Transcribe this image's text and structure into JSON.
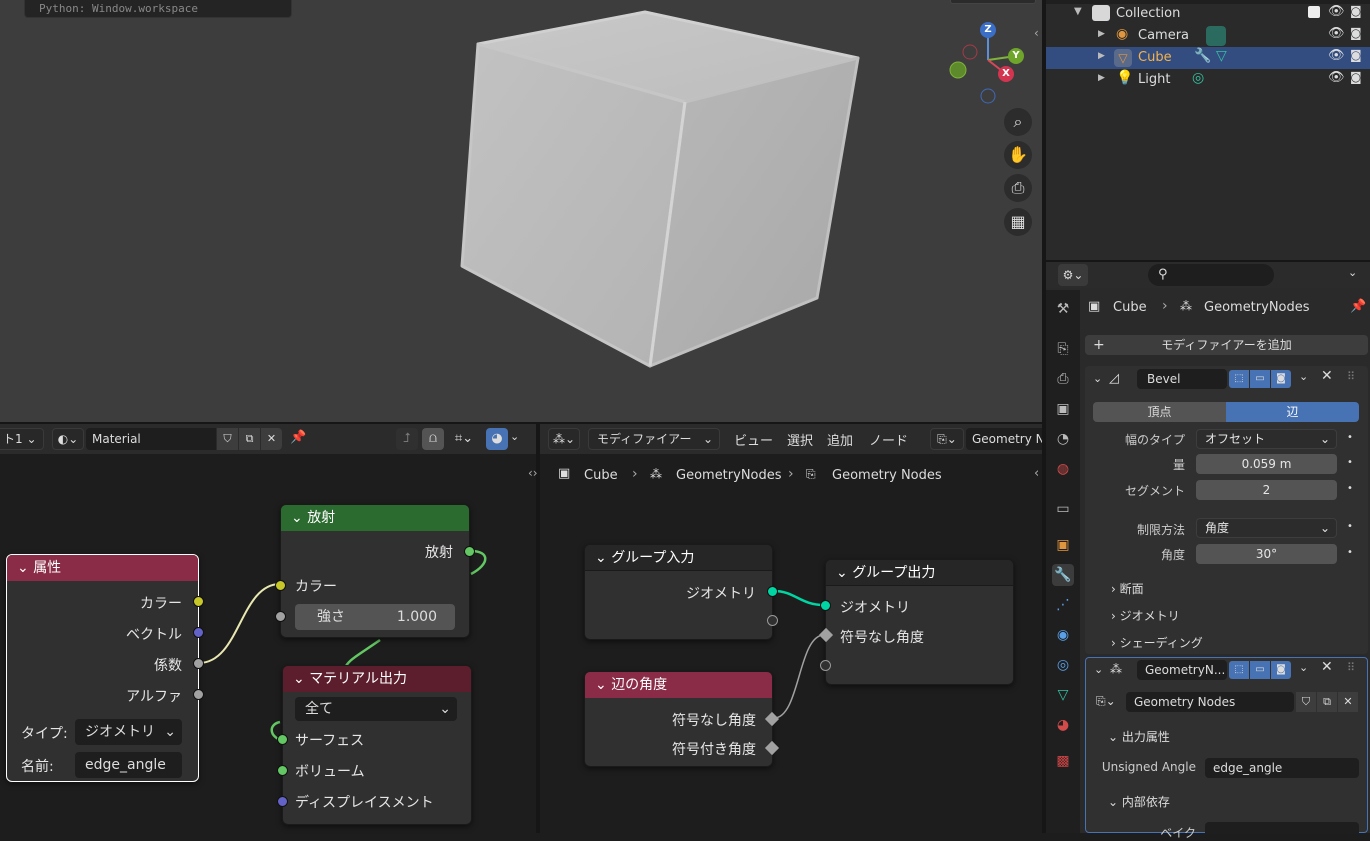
{
  "viewport": {
    "tooltip": "Python: Window.workspace",
    "gizmo": {
      "z": "Z",
      "y": "Y",
      "x": "X"
    }
  },
  "outliner": {
    "rows": [
      {
        "label": "Collection"
      },
      {
        "label": "Camera"
      },
      {
        "label": "Cube"
      },
      {
        "label": "Light"
      }
    ]
  },
  "properties": {
    "breadcrumb": {
      "object": "Cube",
      "modifier": "GeometryNodes"
    },
    "add_modifier": "モディファイアーを追加",
    "bevel": {
      "name": "Bevel",
      "tab_vertex": "頂点",
      "tab_edge": "辺",
      "width_type_label": "幅のタイプ",
      "width_type_value": "オフセット",
      "amount_label": "量",
      "amount_value": "0.059 m",
      "segments_label": "セグメント",
      "segments_value": "2",
      "limit_label": "制限方法",
      "limit_value": "角度",
      "angle_label": "角度",
      "angle_value": "30°",
      "section_profile": "断面",
      "section_geometry": "ジオメトリ",
      "section_shading": "シェーディング"
    },
    "geonodes": {
      "name": "GeometryN...",
      "node_group": "Geometry Nodes",
      "section_output": "出力属性",
      "unsigned_angle_label": "Unsigned Angle",
      "unsigned_angle_value": "edge_angle",
      "section_internal": "内部依存",
      "bake_label": "ベイク"
    }
  },
  "shader_editor": {
    "header": {
      "slot": "ト1",
      "material": "Material"
    },
    "nodes": {
      "attribute": {
        "title": "属性",
        "out_color": "カラー",
        "out_vector": "ベクトル",
        "out_fac": "係数",
        "out_alpha": "アルファ",
        "type_label": "タイプ:",
        "type_value": "ジオメトリ",
        "name_label": "名前:",
        "name_value": "edge_angle"
      },
      "emission": {
        "title": "放射",
        "out_emission": "放射",
        "in_color": "カラー",
        "strength_label": "強さ",
        "strength_value": "1.000"
      },
      "material_output": {
        "title": "マテリアル出力",
        "target": "全て",
        "in_surface": "サーフェス",
        "in_volume": "ボリューム",
        "in_displacement": "ディスプレイスメント"
      }
    }
  },
  "geo_editor": {
    "header": {
      "mode": "モディファイアー",
      "menu_view": "ビュー",
      "menu_select": "選択",
      "menu_add": "追加",
      "menu_node": "ノード",
      "group": "Geometry No"
    },
    "breadcrumb": {
      "object": "Cube",
      "modifier": "GeometryNodes",
      "group": "Geometry Nodes"
    },
    "nodes": {
      "group_input": {
        "title": "グループ入力",
        "out_geometry": "ジオメトリ"
      },
      "group_output": {
        "title": "グループ出力",
        "in_geometry": "ジオメトリ",
        "in_unsigned": "符号なし角度"
      },
      "edge_angle": {
        "title": "辺の角度",
        "out_unsigned": "符号なし角度",
        "out_signed": "符号付き角度"
      }
    }
  },
  "colors": {
    "attr_header": "#8a2c47",
    "emission_header": "#2c6b2f",
    "output_header": "#5c1e2c",
    "selection": "#334d80",
    "geometry_socket": "#00d6a3",
    "color_socket": "#c7c729",
    "vector_socket": "#6363c7",
    "shader_socket": "#63c763",
    "float_socket": "#a1a1a1"
  }
}
